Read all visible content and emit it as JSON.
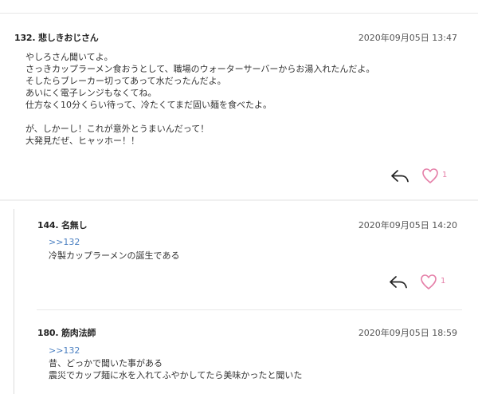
{
  "main_post": {
    "number_name": "132. 悲しきおじさん",
    "date": "2020年09月05日 13:47",
    "body": "やしろさん聞いてよ。\nさっきカップラーメン食おうとして、職場のウォーターサーバーからお湯入れたんだよ。\nそしたらブレーカー切ってあって水だったんだよ。\nあいにく電子レンジもなくてね。\n仕方なく10分くらい待って、冷たくてまだ固い麺を食べたよ。\n\nが、しかーし！これが意外とうまいんだって！\n大発見だぜ、ヒャッホー！！",
    "likes": "1",
    "icons": {
      "reply": "reply-arrow-icon",
      "like": "heart-icon"
    },
    "colors": {
      "heart": "#e57fa8",
      "anchor": "#4a7fc1"
    }
  },
  "replies": [
    {
      "number_name": "144. 名無し",
      "date": "2020年09月05日 14:20",
      "anchor": ">>132",
      "body": "冷製カップラーメンの誕生である",
      "likes": "1"
    },
    {
      "number_name": "180. 筋肉法師",
      "date": "2020年09月05日 18:59",
      "anchor": ">>132",
      "body": "昔、どっかで聞いた事がある\n震災でカップ麺に水を入れてふやかしてたら美味かったと聞いた"
    }
  ]
}
